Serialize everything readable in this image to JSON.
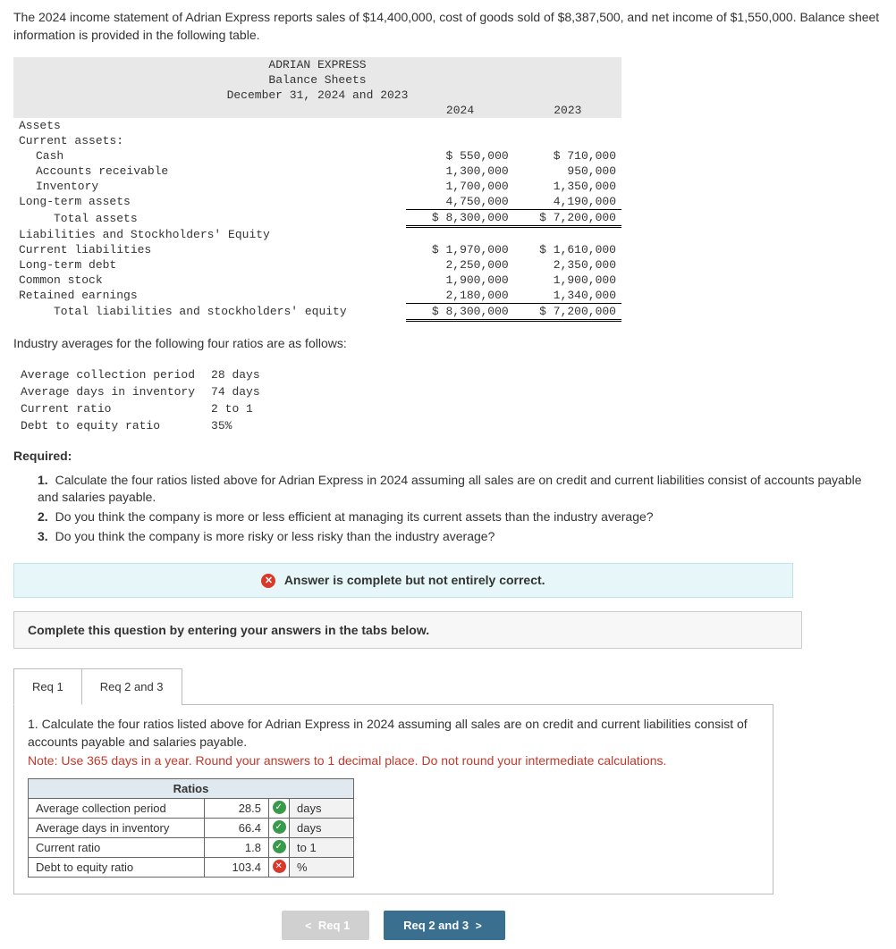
{
  "intro": "The 2024 income statement of Adrian Express reports sales of $14,400,000, cost of goods sold of $8,387,500, and net income of $1,550,000. Balance sheet information is provided in the following table.",
  "bs": {
    "title1": "ADRIAN EXPRESS",
    "title2": "Balance Sheets",
    "title3": "December 31, 2024 and 2023",
    "col1": "2024",
    "col2": "2023",
    "rows": {
      "assets": "Assets",
      "ca": "Current assets:",
      "cash": {
        "l": "Cash",
        "a": "$ 550,000",
        "b": "$ 710,000"
      },
      "ar": {
        "l": "Accounts receivable",
        "a": "1,300,000",
        "b": "950,000"
      },
      "inv": {
        "l": "Inventory",
        "a": "1,700,000",
        "b": "1,350,000"
      },
      "lta": {
        "l": "Long-term assets",
        "a": "4,750,000",
        "b": "4,190,000"
      },
      "tota": {
        "l": "Total assets",
        "a": "$ 8,300,000",
        "b": "$ 7,200,000"
      },
      "lse": "Liabilities and Stockholders' Equity",
      "cl": {
        "l": "Current liabilities",
        "a": "$ 1,970,000",
        "b": "$ 1,610,000"
      },
      "ltd": {
        "l": "Long-term debt",
        "a": "2,250,000",
        "b": "2,350,000"
      },
      "cs": {
        "l": "Common stock",
        "a": "1,900,000",
        "b": "1,900,000"
      },
      "re": {
        "l": "Retained earnings",
        "a": "2,180,000",
        "b": "1,340,000"
      },
      "totl": {
        "l": "Total liabilities and stockholders' equity",
        "a": "$ 8,300,000",
        "b": "$ 7,200,000"
      }
    }
  },
  "indavg_intro": "Industry averages for the following four ratios are as follows:",
  "indavg": [
    {
      "l": "Average collection period",
      "v": "28 days"
    },
    {
      "l": "Average days in inventory",
      "v": "74 days"
    },
    {
      "l": "Current ratio",
      "v": "2 to 1"
    },
    {
      "l": "Debt to equity ratio",
      "v": "35%"
    }
  ],
  "requiredLabel": "Required:",
  "required": [
    "Calculate the four ratios listed above for Adrian Express in 2024 assuming all sales are on credit and current liabilities consist of accounts payable and salaries payable.",
    "Do you think the company is more or less efficient at managing its current assets than the industry average?",
    "Do you think the company is more risky or less risky than the industry average?"
  ],
  "alert": "Answer is complete but not entirely correct.",
  "instruct": "Complete this question by entering your answers in the tabs below.",
  "tabs": {
    "t1": "Req 1",
    "t2": "Req 2 and 3"
  },
  "panel": {
    "head": "1. Calculate the four ratios listed above for Adrian Express in 2024 assuming all sales are on credit and current liabilities consist of accounts payable and salaries payable.",
    "note": "Note: Use 365 days in a year. Round your answers to 1 decimal place. Do not round your intermediate calculations.",
    "colLabel": "Ratios",
    "rows": [
      {
        "l": "Average collection period",
        "v": "28.5",
        "u": "days",
        "ok": true
      },
      {
        "l": "Average days in inventory",
        "v": "66.4",
        "u": "days",
        "ok": true
      },
      {
        "l": "Current ratio",
        "v": "1.8",
        "u": "to 1",
        "ok": true
      },
      {
        "l": "Debt to equity ratio",
        "v": "103.4",
        "u": "%",
        "ok": false
      }
    ]
  },
  "nav": {
    "prev": "Req 1",
    "next": "Req 2 and 3"
  }
}
